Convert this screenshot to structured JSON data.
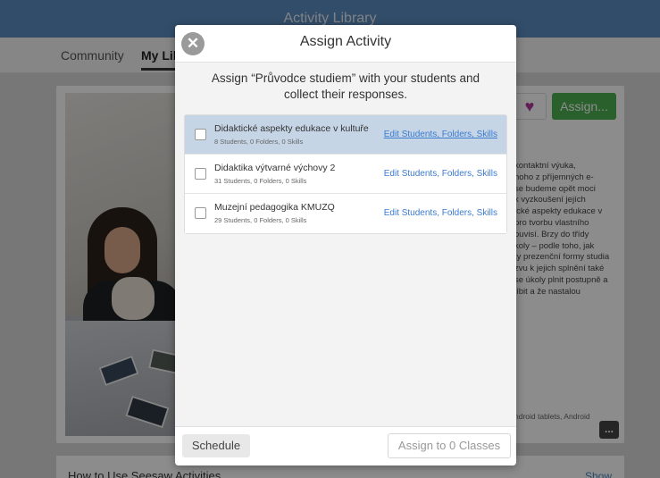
{
  "app": {
    "title": "Activity Library"
  },
  "tabs": [
    {
      "label": "Community"
    },
    {
      "label": "My Library"
    }
  ],
  "activity_card": {
    "heart_icon": "heart-icon",
    "assign_label": "Assign...",
    "description": "kontaktní výuka,\nhoho z příjemných e-\nse budeme opět moci\nk vyzkoušení jejích\nické aspekty edukace v\npro tvorbu vlastního\nouvisí. Brzy do třídy\nkoly – podle toho, jak\nty prezenční formy studia\n zvu k jejich splnění také\nse úkoly plnit postupně a\n líbit a že nastalou",
    "devices": "ndroid tablets, Android",
    "more_label": "..."
  },
  "howto": {
    "title": "How to Use Seesaw Activities",
    "show_label": "Show"
  },
  "modal": {
    "title": "Assign Activity",
    "close_icon": "close-icon",
    "close_glyph": "✕",
    "subtitle": "Assign “Průvodce studiem” with your students and collect their responses.",
    "classes": [
      {
        "name": "Didaktické aspekty edukace v kultuře",
        "meta": "8 Students, 0 Folders, 0 Skills",
        "edit_label": "Edit Students, Folders, Skills",
        "checked": false,
        "highlighted": true
      },
      {
        "name": "Didaktika výtvarné výchovy 2",
        "meta": "31 Students, 0 Folders, 0 Skills",
        "edit_label": "Edit Students, Folders, Skills",
        "checked": false,
        "highlighted": false
      },
      {
        "name": "Muzejní pedagogika KMUZQ",
        "meta": "29 Students, 0 Folders, 0 Skills",
        "edit_label": "Edit Students, Folders, Skills",
        "checked": false,
        "highlighted": false
      }
    ],
    "schedule_label": "Schedule",
    "assign_classes_label": "Assign to 0 Classes"
  },
  "colors": {
    "topbar": "#5b8cc0",
    "assign_green": "#4caf50",
    "link_blue": "#3b7bd0",
    "selected_row": "#c5d5e6",
    "heart": "#b23a9c"
  }
}
